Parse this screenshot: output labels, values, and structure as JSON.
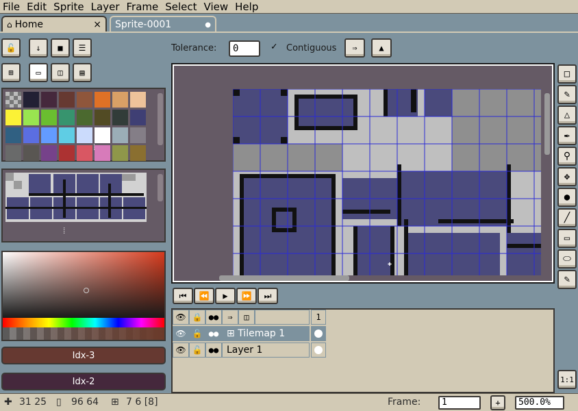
{
  "menu": [
    "File",
    "Edit",
    "Sprite",
    "Layer",
    "Frame",
    "Select",
    "View",
    "Help"
  ],
  "menu_underline": [
    "F",
    "E",
    "S",
    "L",
    "r",
    "S",
    "V",
    "H"
  ],
  "tabs": {
    "home": "Home",
    "sprite": "Sprite-0001",
    "close_glyph": "×",
    "modified_glyph": "●"
  },
  "toolbar": {
    "tolerance_label": "Tolerance:",
    "tolerance_value": "0",
    "contiguous_label": "Contiguous",
    "contiguous_checked": true
  },
  "palette": {
    "colors": [
      "#222034",
      "#45283c",
      "#663931",
      "#8f563b",
      "#df7126",
      "#d9a066",
      "#eec39a",
      "#fbf236",
      "#99e550",
      "#6abe30",
      "#37946e",
      "#4b692f",
      "#524b24",
      "#323c39",
      "#3f3f74",
      "#306082",
      "#5b6ee1",
      "#639bff",
      "#5fcde4",
      "#cbdbfc",
      "#ffffff",
      "#9badb7",
      "#847e87",
      "#696a6a",
      "#595652",
      "#76428a",
      "#ac3232",
      "#d95763",
      "#d77bba",
      "#8f974a",
      "#8a6f30"
    ],
    "resize_glyph": "⁞"
  },
  "color_bars": {
    "fg_label": "Idx-3",
    "fg_color": "#663931",
    "bg_label": "Idx-2",
    "bg_color": "#45283c"
  },
  "timeline": {
    "frame_header": "1",
    "layers": [
      {
        "name": "Tilemap 1",
        "selected": true
      },
      {
        "name": "Layer 1",
        "selected": false
      }
    ]
  },
  "status": {
    "pos": "31 25",
    "size": "96 64",
    "tile": "7 6 [8]",
    "frame_label": "Frame:",
    "frame_value": "1",
    "zoom": "500.0%",
    "one_to_one": "1:1",
    "add_glyph": "+"
  },
  "tools": [
    "marquee-tool",
    "pencil-tool",
    "eraser-tool",
    "eyedropper-tool",
    "zoom-tool",
    "move-tool",
    "fill-tool",
    "line-tool",
    "rectangle-tool",
    "ellipse-tool",
    "blur-tool"
  ]
}
